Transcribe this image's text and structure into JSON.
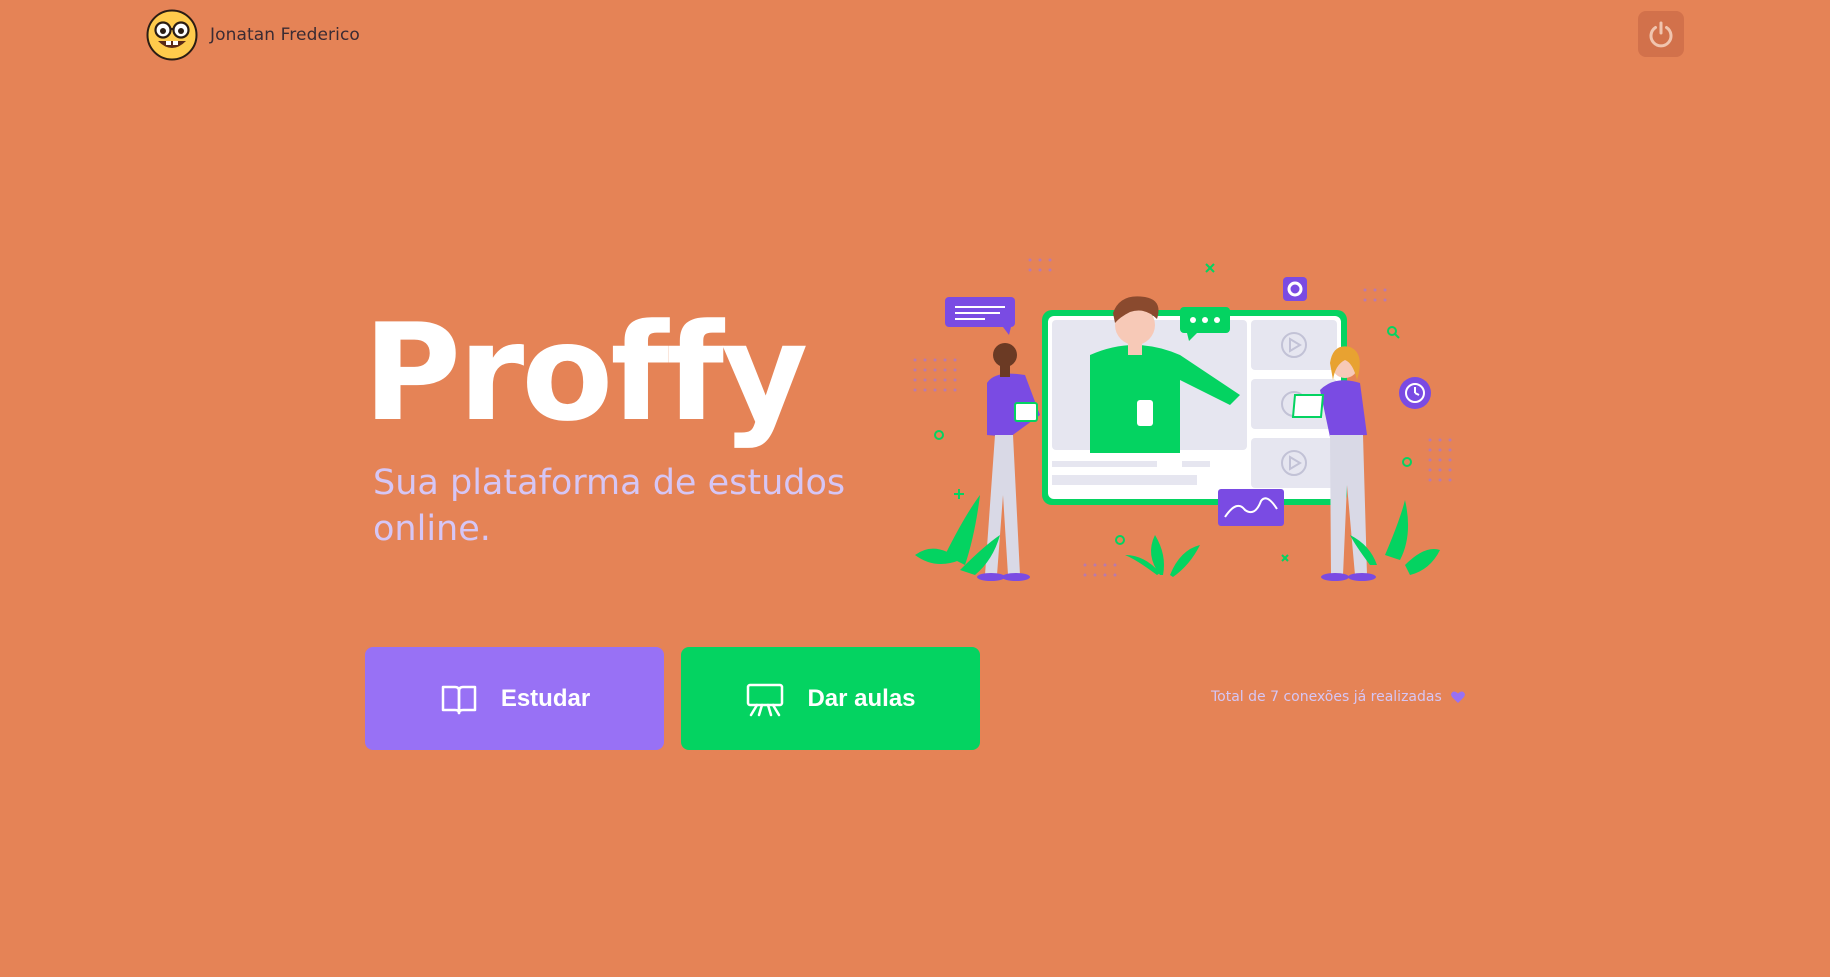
{
  "header": {
    "user_name": "Jonatan Frederico",
    "avatar_icon": "nerd-face-emoji",
    "logout_icon": "power-icon"
  },
  "brand": {
    "logo_text": "Proffy",
    "tagline": "Sua plataforma de estudos online."
  },
  "actions": {
    "study_label": "Estudar",
    "study_icon": "book-icon",
    "teach_label": "Dar aulas",
    "teach_icon": "presentation-board-icon"
  },
  "footer_info": {
    "connections_text": "Total de 7 conexões já realizadas",
    "heart_icon": "purple-heart-icon"
  },
  "colors": {
    "background": "#E58356",
    "primary_purple": "#9871F5",
    "secondary_green": "#04D361",
    "tagline_lilac": "#D6C6F5",
    "logout_bg": "#D2714B"
  }
}
